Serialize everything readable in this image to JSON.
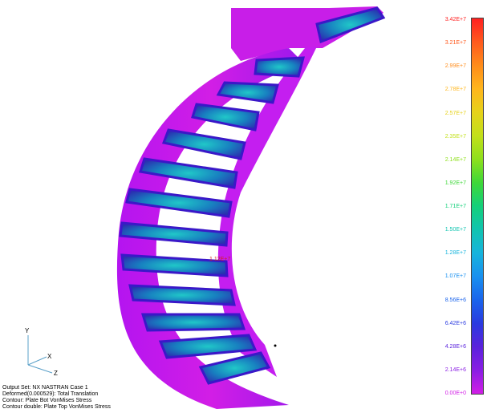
{
  "model": {
    "name": "spiral-staircase"
  },
  "legend": {
    "values": [
      "3.42E+7",
      "3.21E+7",
      "2.99E+7",
      "2.78E+7",
      "2.57E+7",
      "2.35E+7",
      "2.14E+7",
      "1.92E+7",
      "1.71E+7",
      "1.50E+7",
      "1.28E+7",
      "1.07E+7",
      "8.56E+6",
      "6.42E+6",
      "4.28E+6",
      "2.14E+6",
      "0.00E+0"
    ],
    "colors": [
      "#ff2020",
      "#ff5a1e",
      "#ff8c1a",
      "#ffb61c",
      "#e6d21a",
      "#c2e01a",
      "#8ee01c",
      "#3ed838",
      "#14d07a",
      "#10c4b0",
      "#16b4dc",
      "#1890f0",
      "#1a64ec",
      "#2a3ae0",
      "#5a22dc",
      "#8a1ee4",
      "#d21ee6"
    ]
  },
  "axes": {
    "x": "X",
    "y": "Y",
    "z": "Z"
  },
  "probe": {
    "text": "1.12E+7"
  },
  "info": {
    "lines": [
      "Output Set: NX NASTRAN Case 1",
      "Deformed(0.000529): Total Translation",
      "Contour: Plate Bot VonMises Stress",
      "Contour double: Plate Top VonMises Stress"
    ]
  }
}
